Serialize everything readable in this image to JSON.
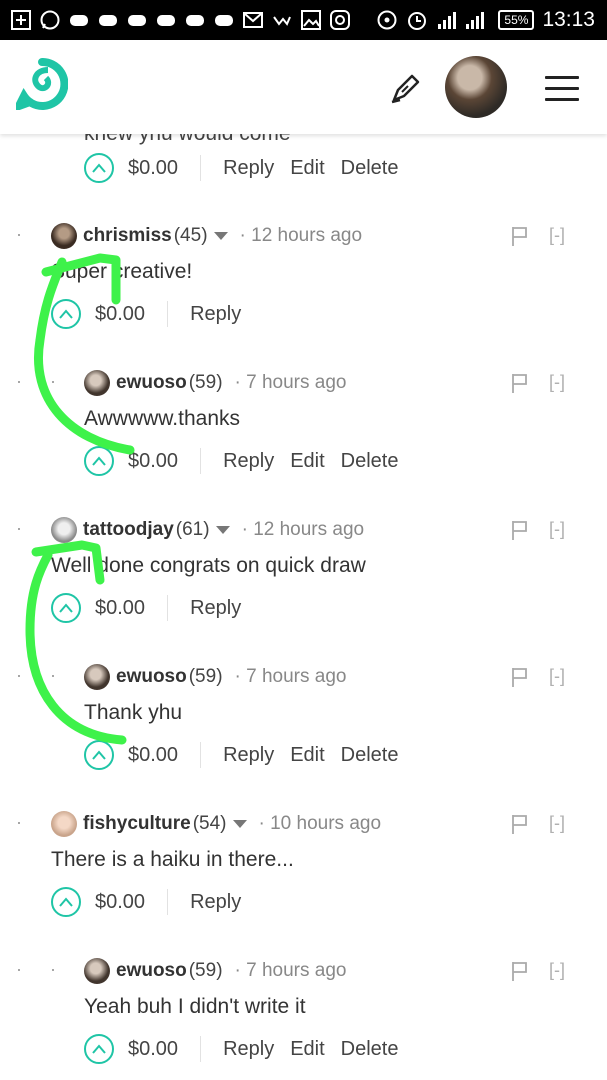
{
  "status_bar": {
    "battery": "55%",
    "time": "13:13",
    "left_icons": [
      "plus-icon",
      "whatsapp-icon",
      "game-icon",
      "game-icon",
      "game-icon",
      "game-icon",
      "game-icon",
      "game-icon",
      "mail-icon",
      "check-icon",
      "image-icon",
      "instagram-icon"
    ]
  },
  "header": {
    "logo_icon": "speech-bubble-logo-icon",
    "edit_icon": "pen-icon",
    "menu_icon": "hamburger-menu-icon"
  },
  "colors": {
    "accent": "#1fc5a6",
    "annotation": "#3ef24a"
  },
  "truncated_text": "knew yhu would come",
  "comments": [
    {
      "indent": 1,
      "user": "",
      "rep": "",
      "time": "",
      "body": "",
      "amount": "$0.00",
      "actions": [
        "Reply",
        "Edit",
        "Delete"
      ]
    },
    {
      "indent": 0,
      "user": "chrismiss",
      "rep": "(45)",
      "time": "12 hours ago",
      "body": "Super creative!",
      "amount": "$0.00",
      "actions": [
        "Reply"
      ],
      "collapse": "[-]"
    },
    {
      "indent": 1,
      "user": "ewuoso",
      "rep": "(59)",
      "time": "7 hours ago",
      "body": "Awwwww.thanks",
      "amount": "$0.00",
      "actions": [
        "Reply",
        "Edit",
        "Delete"
      ],
      "collapse": "[-]"
    },
    {
      "indent": 0,
      "user": "tattoodjay",
      "rep": "(61)",
      "time": "12 hours ago",
      "body": "Well done congrats on quick draw",
      "amount": "$0.00",
      "actions": [
        "Reply"
      ],
      "collapse": "[-]"
    },
    {
      "indent": 1,
      "user": "ewuoso",
      "rep": "(59)",
      "time": "7 hours ago",
      "body": "Thank yhu",
      "amount": "$0.00",
      "actions": [
        "Reply",
        "Edit",
        "Delete"
      ],
      "collapse": "[-]"
    },
    {
      "indent": 0,
      "user": "fishyculture",
      "rep": "(54)",
      "time": "10 hours ago",
      "body": "There is a haiku in there...",
      "amount": "$0.00",
      "actions": [
        "Reply"
      ],
      "collapse": "[-]"
    },
    {
      "indent": 1,
      "user": "ewuoso",
      "rep": "(59)",
      "time": "7 hours ago",
      "body": "Yeah buh I didn't write it",
      "amount": "$0.00",
      "actions": [
        "Reply",
        "Edit",
        "Delete"
      ],
      "collapse": "[-]"
    }
  ]
}
